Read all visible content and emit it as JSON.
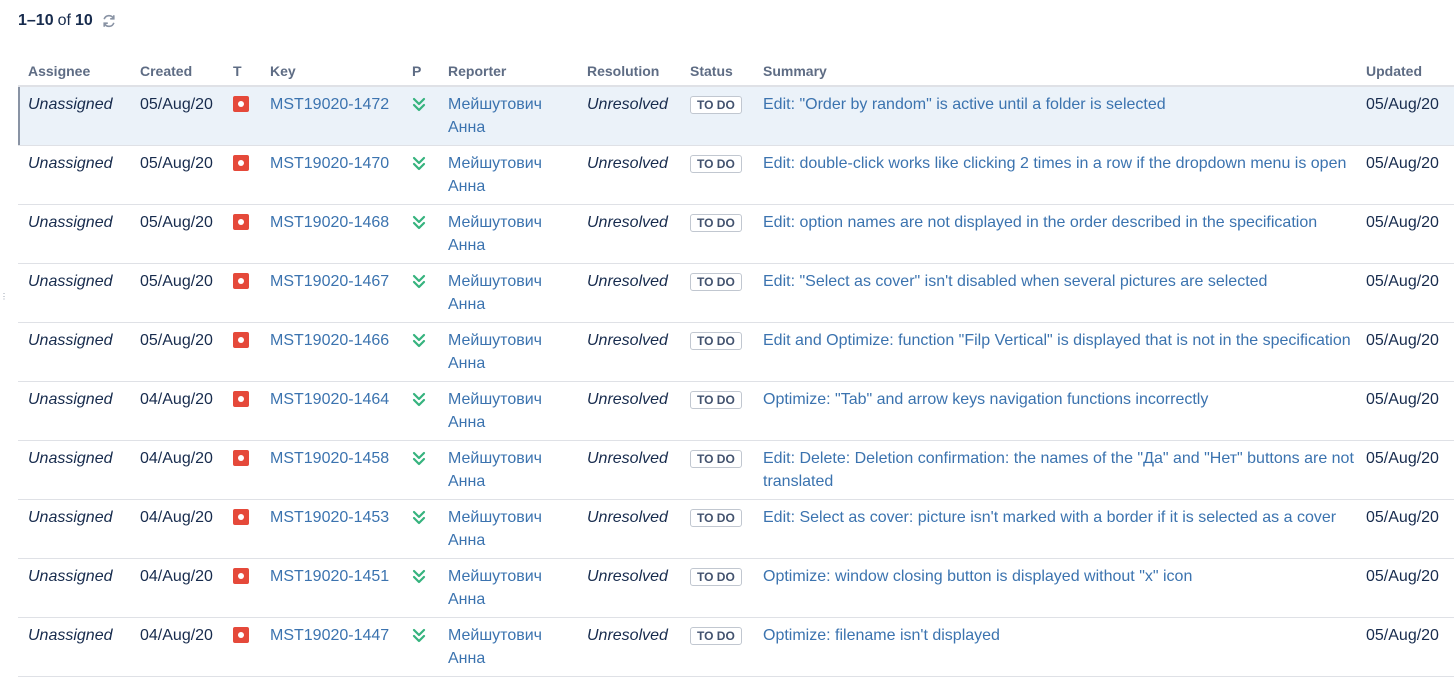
{
  "pager": {
    "range": "1–10",
    "of": "of",
    "total": "10",
    "refresh_icon": "refresh-icon"
  },
  "columns": {
    "assignee": "Assignee",
    "created": "Created",
    "type": "T",
    "key": "Key",
    "priority": "P",
    "reporter": "Reporter",
    "resolution": "Resolution",
    "status": "Status",
    "summary": "Summary",
    "updated": "Updated"
  },
  "icons": {
    "type": "bug-icon",
    "priority": "lowest-priority-icon",
    "bug_color": "#e5493a",
    "priority_color": "#36b37e"
  },
  "colors": {
    "link": "#3b73af",
    "selected_row": "#ebf2f9",
    "header_text": "#5e6c84"
  },
  "issues": [
    {
      "assignee": "Unassigned",
      "created": "05/Aug/20",
      "key": "MST19020-1472",
      "reporter_line1": "Мейшутович",
      "reporter_line2": "Анна",
      "resolution": "Unresolved",
      "status": "TO DO",
      "summary": "Edit: \"Order by random\" is active until a folder is selected",
      "updated": "05/Aug/20"
    },
    {
      "assignee": "Unassigned",
      "created": "05/Aug/20",
      "key": "MST19020-1470",
      "reporter_line1": "Мейшутович",
      "reporter_line2": "Анна",
      "resolution": "Unresolved",
      "status": "TO DO",
      "summary": "Edit: double-click works like clicking 2 times in a row if the dropdown menu is open",
      "updated": "05/Aug/20"
    },
    {
      "assignee": "Unassigned",
      "created": "05/Aug/20",
      "key": "MST19020-1468",
      "reporter_line1": "Мейшутович",
      "reporter_line2": "Анна",
      "resolution": "Unresolved",
      "status": "TO DO",
      "summary": "Edit: option names are not displayed in the order described in the specification",
      "updated": "05/Aug/20"
    },
    {
      "assignee": "Unassigned",
      "created": "05/Aug/20",
      "key": "MST19020-1467",
      "reporter_line1": "Мейшутович",
      "reporter_line2": "Анна",
      "resolution": "Unresolved",
      "status": "TO DO",
      "summary": "Edit: \"Select as cover\" isn't disabled when several pictures are selected",
      "updated": "05/Aug/20"
    },
    {
      "assignee": "Unassigned",
      "created": "05/Aug/20",
      "key": "MST19020-1466",
      "reporter_line1": "Мейшутович",
      "reporter_line2": "Анна",
      "resolution": "Unresolved",
      "status": "TO DO",
      "summary": "Edit and Optimize: function \"Filp Vertical\" is displayed that is not in the specification",
      "updated": "05/Aug/20"
    },
    {
      "assignee": "Unassigned",
      "created": "04/Aug/20",
      "key": "MST19020-1464",
      "reporter_line1": "Мейшутович",
      "reporter_line2": "Анна",
      "resolution": "Unresolved",
      "status": "TO DO",
      "summary": "Optimize: \"Tab\" and arrow keys navigation functions incorrectly",
      "updated": "05/Aug/20"
    },
    {
      "assignee": "Unassigned",
      "created": "04/Aug/20",
      "key": "MST19020-1458",
      "reporter_line1": "Мейшутович",
      "reporter_line2": "Анна",
      "resolution": "Unresolved",
      "status": "TO DO",
      "summary": "Edit: Delete: Deletion confirmation: the names of the \"Да\" and \"Нет\" buttons are not translated",
      "updated": "05/Aug/20"
    },
    {
      "assignee": "Unassigned",
      "created": "04/Aug/20",
      "key": "MST19020-1453",
      "reporter_line1": "Мейшутович",
      "reporter_line2": "Анна",
      "resolution": "Unresolved",
      "status": "TO DO",
      "summary": "Edit: Select as cover: picture isn't marked with a border if it is selected as a cover",
      "updated": "05/Aug/20"
    },
    {
      "assignee": "Unassigned",
      "created": "04/Aug/20",
      "key": "MST19020-1451",
      "reporter_line1": "Мейшутович",
      "reporter_line2": "Анна",
      "resolution": "Unresolved",
      "status": "TO DO",
      "summary": "Optimize: window closing button is displayed without \"x\" icon",
      "updated": "05/Aug/20"
    },
    {
      "assignee": "Unassigned",
      "created": "04/Aug/20",
      "key": "MST19020-1447",
      "reporter_line1": "Мейшутович",
      "reporter_line2": "Анна",
      "resolution": "Unresolved",
      "status": "TO DO",
      "summary": "Optimize: filename isn't displayed",
      "updated": "05/Aug/20"
    }
  ]
}
